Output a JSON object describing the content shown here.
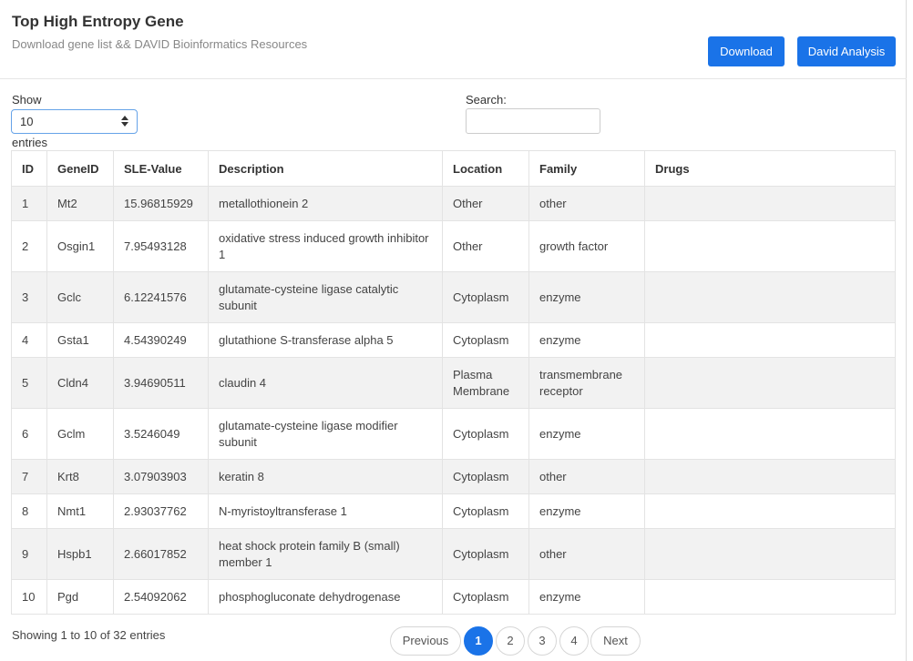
{
  "header": {
    "title": "Top High Entropy Gene",
    "subtitle": "Download gene list && DAVID Bioinformatics Resources",
    "download_label": "Download",
    "david_label": "David Analysis"
  },
  "length": {
    "show_label": "Show",
    "selected": "10",
    "entries_label": "entries"
  },
  "search": {
    "label": "Search:",
    "value": ""
  },
  "table": {
    "columns": [
      "ID",
      "GeneID",
      "SLE-Value",
      "Description",
      "Location",
      "Family",
      "Drugs"
    ],
    "rows": [
      {
        "id": "1",
        "gene": "Mt2",
        "sle": "15.96815929",
        "desc": "metallothionein 2",
        "loc": "Other",
        "family": "other",
        "drugs": ""
      },
      {
        "id": "2",
        "gene": "Osgin1",
        "sle": "7.95493128",
        "desc": "oxidative stress induced growth inhibitor 1",
        "loc": "Other",
        "family": "growth factor",
        "drugs": ""
      },
      {
        "id": "3",
        "gene": "Gclc",
        "sle": "6.12241576",
        "desc": "glutamate-cysteine ligase catalytic subunit",
        "loc": "Cytoplasm",
        "family": "enzyme",
        "drugs": ""
      },
      {
        "id": "4",
        "gene": "Gsta1",
        "sle": "4.54390249",
        "desc": "glutathione S-transferase alpha 5",
        "loc": "Cytoplasm",
        "family": "enzyme",
        "drugs": ""
      },
      {
        "id": "5",
        "gene": "Cldn4",
        "sle": "3.94690511",
        "desc": "claudin 4",
        "loc": "Plasma Membrane",
        "family": "transmembrane receptor",
        "drugs": ""
      },
      {
        "id": "6",
        "gene": "Gclm",
        "sle": "3.5246049",
        "desc": "glutamate-cysteine ligase modifier subunit",
        "loc": "Cytoplasm",
        "family": "enzyme",
        "drugs": ""
      },
      {
        "id": "7",
        "gene": "Krt8",
        "sle": "3.07903903",
        "desc": "keratin 8",
        "loc": "Cytoplasm",
        "family": "other",
        "drugs": ""
      },
      {
        "id": "8",
        "gene": "Nmt1",
        "sle": "2.93037762",
        "desc": "N-myristoyltransferase 1",
        "loc": "Cytoplasm",
        "family": "enzyme",
        "drugs": ""
      },
      {
        "id": "9",
        "gene": "Hspb1",
        "sle": "2.66017852",
        "desc": "heat shock protein family B (small) member 1",
        "loc": "Cytoplasm",
        "family": "other",
        "drugs": ""
      },
      {
        "id": "10",
        "gene": "Pgd",
        "sle": "2.54092062",
        "desc": "phosphogluconate dehydrogenase",
        "loc": "Cytoplasm",
        "family": "enzyme",
        "drugs": ""
      }
    ]
  },
  "footer": {
    "info": "Showing 1 to 10 of 32 entries",
    "previous_label": "Previous",
    "next_label": "Next",
    "pages": [
      "1",
      "2",
      "3",
      "4"
    ],
    "current_page": "1"
  },
  "colors": {
    "accent": "#1a73e8",
    "stripe": "#f2f2f2"
  }
}
